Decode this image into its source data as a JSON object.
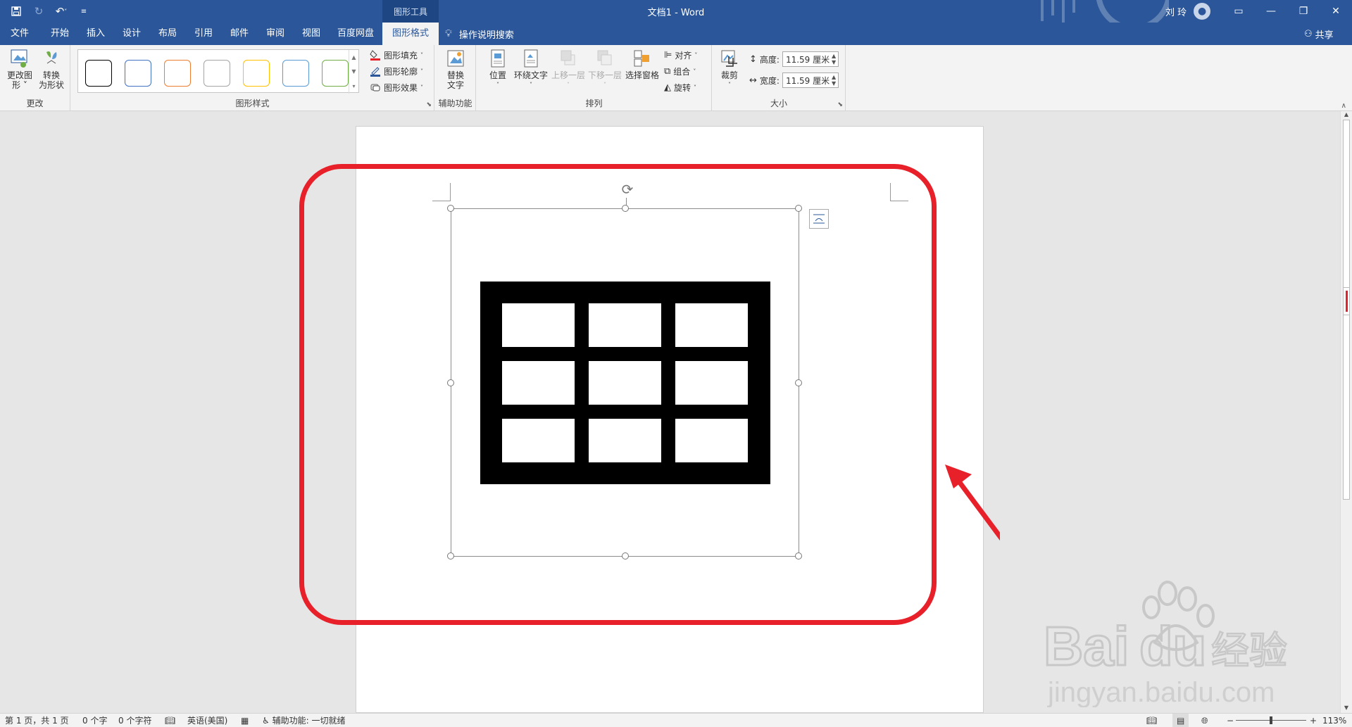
{
  "titlebar": {
    "doc_title": "文档1  -  Word",
    "contextual_tab": "图形工具",
    "user_name": "刘 玲",
    "qat": [
      "save-icon",
      "redo-icon",
      "undo-icon",
      "customize-icon"
    ]
  },
  "tabs": [
    {
      "label": "文件"
    },
    {
      "label": "开始"
    },
    {
      "label": "插入"
    },
    {
      "label": "设计"
    },
    {
      "label": "布局"
    },
    {
      "label": "引用"
    },
    {
      "label": "邮件"
    },
    {
      "label": "审阅"
    },
    {
      "label": "视图"
    },
    {
      "label": "百度网盘"
    },
    {
      "label": "图形格式"
    }
  ],
  "tellme": "操作说明搜索",
  "share": "共享",
  "ribbon": {
    "change": {
      "label": "更改",
      "change_graphic": "更改图\n形 ˅",
      "convert_shape": "转换\n为形状"
    },
    "styles": {
      "label": "图形样式",
      "swatch_colors": [
        "#000000",
        "#4472c4",
        "#ed7d31",
        "#a5a5a5",
        "#ffc000",
        "#5b9bd5",
        "#70ad47"
      ],
      "fill": "图形填充",
      "outline": "图形轮廓",
      "effects": "图形效果"
    },
    "accessibility": {
      "label": "辅助功能",
      "alt_text": "替换\n文字"
    },
    "arrange": {
      "label": "排列",
      "position": "位置",
      "wrap": "环绕文字",
      "forward": "上移一层",
      "backward": "下移一层",
      "selection_pane": "选择窗格",
      "align": "对齐",
      "group": "组合",
      "rotate": "旋转"
    },
    "size": {
      "label": "大小",
      "crop": "裁剪",
      "height_label": "高度:",
      "height_value": "11.59 厘米",
      "width_label": "宽度:",
      "width_value": "11.59 厘米"
    }
  },
  "statusbar": {
    "page": "第 1 页，共 1 页",
    "words": "0 个字",
    "chars": "0 个字符",
    "language": "英语(美国)",
    "accessibility": "辅助功能: 一切就绪",
    "zoom": "113%"
  },
  "watermark": {
    "brand": "Bai",
    "brand2": "du",
    "cn": "经验",
    "url": "jingyan.baidu.com"
  },
  "colors": {
    "word_blue": "#2b579a",
    "annotation_red": "#e8202a"
  }
}
